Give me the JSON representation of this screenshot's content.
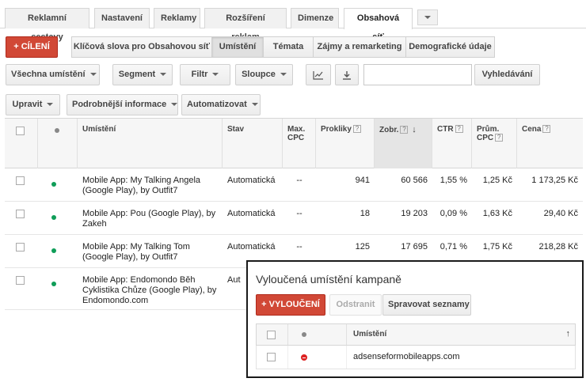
{
  "tabs": [
    "Reklamní sestavy",
    "Nastavení",
    "Reklamy",
    "Rozšíření reklam",
    "Dimenze",
    "Obsahová síť"
  ],
  "targeting_button": "+ CÍLENÍ",
  "subtabs": [
    "Klíčová slova pro Obsahovou síť",
    "Umístění",
    "Témata",
    "Zájmy a remarketing",
    "Demografické údaje"
  ],
  "toolbar1": {
    "all_placements": "Všechna umístění",
    "segment": "Segment",
    "filter": "Filtr",
    "columns": "Sloupce",
    "search_value": "",
    "search_button": "Vyhledávání"
  },
  "toolbar2": {
    "edit": "Upravit",
    "details": "Podrobnější informace",
    "automate": "Automatizovat"
  },
  "table": {
    "columns": {
      "placement": "Umístění",
      "status": "Stav",
      "max_cpc": "Max. CPC",
      "clicks": "Prokliky",
      "impr": "Zobr.",
      "ctr": "CTR",
      "avg_cpc": "Prům. CPC",
      "cost": "Cena"
    },
    "rows": [
      {
        "placement": "Mobile App: My Talking Angela (Google Play), by Outfit7",
        "status": "Automatická",
        "max_cpc": "--",
        "clicks": "941",
        "impr": "60 566",
        "ctr": "1,55 %",
        "avg_cpc": "1,25 Kč",
        "cost": "1 173,25 Kč"
      },
      {
        "placement": "Mobile App: Pou (Google Play), by Zakeh",
        "status": "Automatická",
        "max_cpc": "--",
        "clicks": "18",
        "impr": "19 203",
        "ctr": "0,09 %",
        "avg_cpc": "1,63 Kč",
        "cost": "29,40 Kč"
      },
      {
        "placement": "Mobile App: My Talking Tom (Google Play), by Outfit7",
        "status": "Automatická",
        "max_cpc": "--",
        "clicks": "125",
        "impr": "17 695",
        "ctr": "0,71 %",
        "avg_cpc": "1,75 Kč",
        "cost": "218,28 Kč"
      },
      {
        "placement": "Mobile App: Endomondo Běh Cyklistika Chůze (Google Play), by Endomondo.com",
        "status": "Aut",
        "max_cpc": "",
        "clicks": "",
        "impr": "",
        "ctr": "",
        "avg_cpc": "",
        "cost": ""
      }
    ]
  },
  "excluded_panel": {
    "title": "Vyloučená umístění kampaně",
    "exclude_button": "+ VYLOUČENÍ",
    "remove_button": "Odstranit",
    "manage_lists_button": "Spravovat seznamy",
    "column_placement": "Umístění",
    "rows": [
      {
        "placement": "adsenseformobileapps.com"
      }
    ]
  },
  "colors": {
    "accent_red": "#d14836",
    "status_green": "#0f9d58",
    "excluded_red": "#dd2222"
  }
}
